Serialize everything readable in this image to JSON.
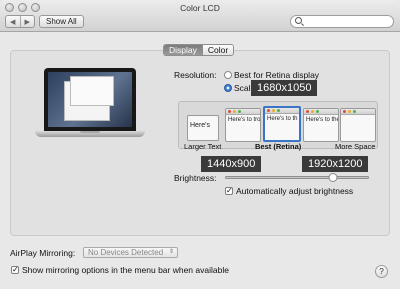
{
  "window": {
    "title": "Color LCD"
  },
  "toolbar": {
    "back_glyph": "◀",
    "forward_glyph": "▶",
    "show_all": "Show All",
    "search_placeholder": ""
  },
  "tabs": [
    {
      "label": "Display",
      "active": true
    },
    {
      "label": "Color",
      "active": false
    }
  ],
  "resolution": {
    "label": "Resolution:",
    "options": [
      {
        "label": "Best for Retina display",
        "selected": false
      },
      {
        "label": "Scaled",
        "selected": true
      }
    ],
    "scale_choices": [
      {
        "sample": "Here's",
        "selected": false
      },
      {
        "sample": "Here's to troublema",
        "selected": false
      },
      {
        "sample": "Here's to th troublemak",
        "selected": true
      },
      {
        "sample": "Here's to the troublemakers",
        "selected": false
      },
      {
        "sample": "",
        "selected": false
      }
    ],
    "scale_labels": {
      "left": "Larger Text",
      "center": "Best (Retina)",
      "right": "More Space"
    },
    "tooltips": [
      "1680x1050",
      "1440x900",
      "1920x1200"
    ]
  },
  "brightness": {
    "label": "Brightness:",
    "level": 0.75,
    "auto_label": "Automatically adjust brightness",
    "auto_checked": true
  },
  "airplay": {
    "label": "AirPlay Mirroring:",
    "value": "No Devices Detected",
    "arrow_glyph": "⇕"
  },
  "mirroring": {
    "label": "Show mirroring options in the menu bar when available",
    "checked": true
  },
  "help": {
    "glyph": "?"
  },
  "check_glyph": "✓"
}
